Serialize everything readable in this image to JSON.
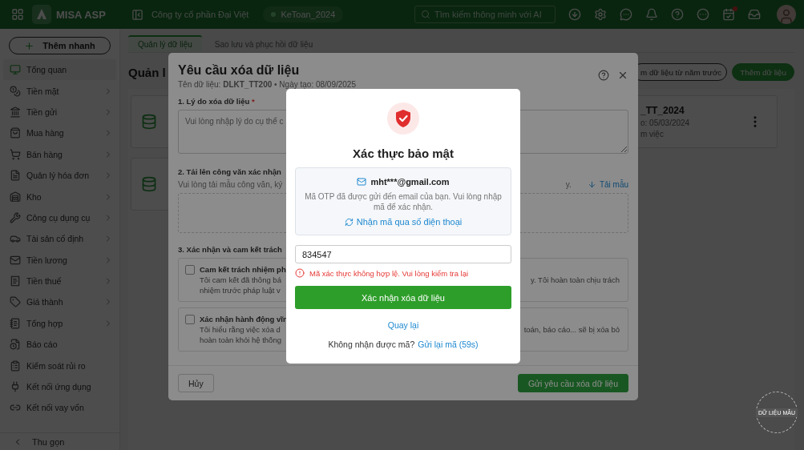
{
  "topbar": {
    "logo": "MISA ASP",
    "company": "Công ty cổ phần Đại Việt",
    "database": "KeToan_2024",
    "search": {
      "placeholder": "Tìm kiếm thông minh với AI"
    }
  },
  "sidebar": {
    "add_button": "Thêm nhanh",
    "items": [
      {
        "label": "Tổng quan",
        "selected": true,
        "expandable": false
      },
      {
        "label": "Tiền mặt",
        "selected": false,
        "expandable": true
      },
      {
        "label": "Tiền gửi",
        "selected": false,
        "expandable": true
      },
      {
        "label": "Mua hàng",
        "selected": false,
        "expandable": true
      },
      {
        "label": "Bán hàng",
        "selected": false,
        "expandable": true
      },
      {
        "label": "Quản lý hóa đơn",
        "selected": false,
        "expandable": true
      },
      {
        "label": "Kho",
        "selected": false,
        "expandable": true
      },
      {
        "label": "Công cụ dụng cụ",
        "selected": false,
        "expandable": true
      },
      {
        "label": "Tài sản cố định",
        "selected": false,
        "expandable": true
      },
      {
        "label": "Tiền lương",
        "selected": false,
        "expandable": true
      },
      {
        "label": "Tiền thuế",
        "selected": false,
        "expandable": true
      },
      {
        "label": "Giá thành",
        "selected": false,
        "expandable": true
      },
      {
        "label": "Tổng hợp",
        "selected": false,
        "expandable": true
      },
      {
        "label": "Báo cáo",
        "selected": false,
        "expandable": false
      },
      {
        "label": "Kiểm soát rủi ro",
        "selected": false,
        "expandable": false
      },
      {
        "label": "Kết nối ứng dụng",
        "selected": false,
        "expandable": false
      },
      {
        "label": "Kết nối vay vốn",
        "selected": false,
        "expandable": false
      }
    ],
    "collapse": "Thu gọn"
  },
  "main": {
    "tabs": [
      {
        "label": "Quản lý dữ liệu",
        "selected": true
      },
      {
        "label": "Sao lưu và phục hồi dữ liệu",
        "selected": false
      }
    ],
    "title": "Quản l",
    "buttons": [
      {
        "label": "m dữ liệu từ năm trước",
        "kind": "outline"
      },
      {
        "label": "Thêm dữ liệu",
        "kind": "primary"
      }
    ],
    "cards": [
      {
        "name": "_TT_2024",
        "date": "o: 05/03/2024",
        "status": "m việc",
        "menu": true
      },
      {
        "menu": false
      }
    ]
  },
  "delete_dialog": {
    "title": "Yêu cầu xóa dữ liệu",
    "subtitle": "Tên dữ liệu: **DLKT_TT200** • Ngày tạo: 08/09/2025",
    "reason": {
      "label": "1. Lý do xóa dữ liệu",
      "required_mark": "*",
      "placeholder": "Vui lòng nhập lý do cụ thể c"
    },
    "upload": {
      "label": "2. Tải lên công văn xác nhận",
      "hint": "Vui lòng tải mẫu công văn, ký",
      "hint_end": "y.",
      "link": "Tải mẫu"
    },
    "commit": {
      "label": "3. Xác nhận và cam kết trách",
      "items": [
        {
          "title": "Cam kết trách nhiệm ph",
          "checked": false,
          "lines": [
            {
              "left": "Tôi cam kết đã thông bá",
              "right": "y. Tôi hoàn toàn chịu trách"
            },
            {
              "left": "nhiệm trước pháp luật v"
            }
          ]
        },
        {
          "title": "Xác nhận hành động vĩn",
          "checked": false,
          "lines": [
            {
              "left": "Tôi hiểu rằng việc xóa d",
              "right": "toán, báo cáo... sẽ bị xóa bỏ"
            },
            {
              "left": "hoàn toàn khỏi hệ thống"
            }
          ]
        }
      ]
    },
    "cancel": "Hủy",
    "submit": "Gửi yêu cầu xóa dữ liệu"
  },
  "otp_dialog": {
    "title": "Xác thực bảo mật",
    "email": "mht***@gmail.com",
    "message": "Mã OTP đã được gửi đến email của bạn. Vui lòng nhập mã để xác nhận.",
    "switch_link": "Nhận mã qua số điện thoại",
    "code": "834547",
    "error": "Mã xác thực không hợp lệ. Vui lòng kiểm tra lại",
    "confirm": "Xác nhận xóa dữ liệu",
    "back": "Quay lại",
    "resend_prompt": "Không nhận được mã?",
    "resend_link": "Gửi lại mã (59s)"
  },
  "stamp": "DỮ LIỆU MẪU"
}
